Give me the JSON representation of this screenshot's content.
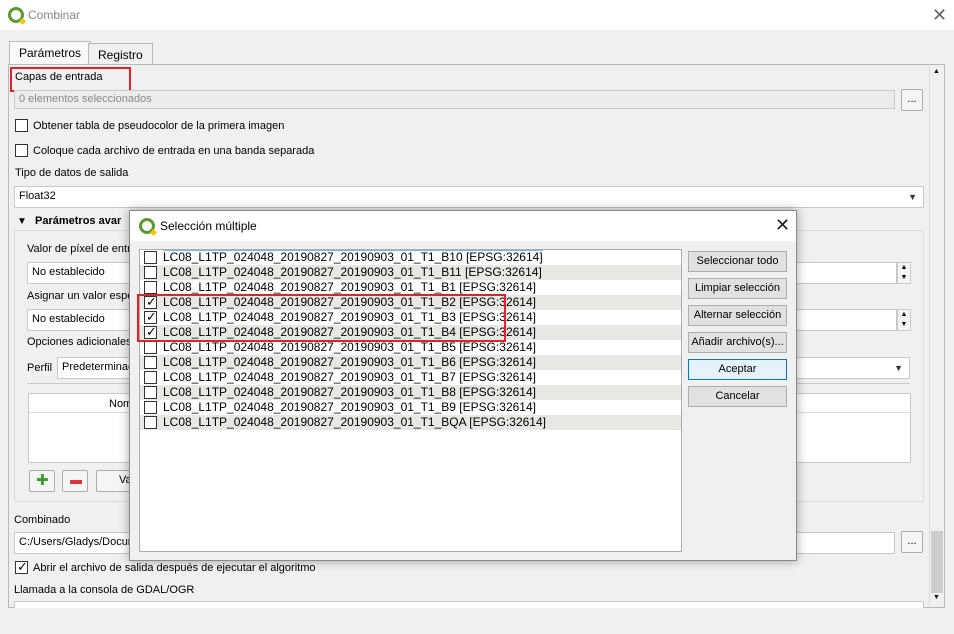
{
  "window": {
    "title": "Combinar"
  },
  "tabs": [
    {
      "label": "Parámetros"
    },
    {
      "label": "Registro"
    }
  ],
  "params": {
    "input_layers_label": "Capas de entrada",
    "input_layers_value": "0 elementos seleccionados",
    "browse_label": "...",
    "pct_checkbox_label": "Obtener tabla de pseudocolor de la primera imagen",
    "separate_checkbox_label": "Coloque cada archivo de entrada en una banda separada",
    "datatype_label": "Tipo de datos de salida",
    "datatype_value": "Float32",
    "advanced_label": "Parámetros avar",
    "pixel_value_label": "Valor de píxel de entra",
    "pixel_value": "No establecido",
    "assign_value_label": "Asignar un valor espe",
    "assign_value": "No establecido",
    "extra_options_label": "Opciones adicionales",
    "profile_label": "Perfil",
    "profile_value": "Predeterminad",
    "table_header": "Nom",
    "values_btn": "Va",
    "output_label": "Combinado",
    "output_value": "C:/Users/Gladys/Docum",
    "open_output_label": "Abrir el archivo de salida después de ejecutar el algoritmo",
    "console_label": "Llamada a la consola de GDAL/OGR"
  },
  "dialog": {
    "title": "Selección múltiple",
    "items": [
      {
        "label": "LC08_L1TP_024048_20190827_20190903_01_T1_B10 [EPSG:32614]",
        "checked": false
      },
      {
        "label": "LC08_L1TP_024048_20190827_20190903_01_T1_B11 [EPSG:32614]",
        "checked": false
      },
      {
        "label": "LC08_L1TP_024048_20190827_20190903_01_T1_B1 [EPSG:32614]",
        "checked": false
      },
      {
        "label": "LC08_L1TP_024048_20190827_20190903_01_T1_B2 [EPSG:32614]",
        "checked": true
      },
      {
        "label": "LC08_L1TP_024048_20190827_20190903_01_T1_B3 [EPSG:32614]",
        "checked": true
      },
      {
        "label": "LC08_L1TP_024048_20190827_20190903_01_T1_B4 [EPSG:32614]",
        "checked": true
      },
      {
        "label": "LC08_L1TP_024048_20190827_20190903_01_T1_B5 [EPSG:32614]",
        "checked": false
      },
      {
        "label": "LC08_L1TP_024048_20190827_20190903_01_T1_B6 [EPSG:32614]",
        "checked": false
      },
      {
        "label": "LC08_L1TP_024048_20190827_20190903_01_T1_B7 [EPSG:32614]",
        "checked": false
      },
      {
        "label": "LC08_L1TP_024048_20190827_20190903_01_T1_B8 [EPSG:32614]",
        "checked": false
      },
      {
        "label": "LC08_L1TP_024048_20190827_20190903_01_T1_B9 [EPSG:32614]",
        "checked": false
      },
      {
        "label": "LC08_L1TP_024048_20190827_20190903_01_T1_BQA [EPSG:32614]",
        "checked": false
      }
    ],
    "buttons": {
      "select_all": "Seleccionar todo",
      "clear": "Limpiar selección",
      "toggle": "Alternar selección",
      "add_files": "Añadir archivo(s)...",
      "ok": "Aceptar",
      "cancel": "Cancelar"
    }
  },
  "colors": {
    "highlight": "#e0232b",
    "qgis_green": "#5a9a31",
    "primary_border": "#0078d7"
  },
  "icons": [
    "qgis-logo-icon",
    "close-icon",
    "chevron-down-icon",
    "collapse-triangle-icon",
    "plus-icon",
    "minus-icon"
  ]
}
